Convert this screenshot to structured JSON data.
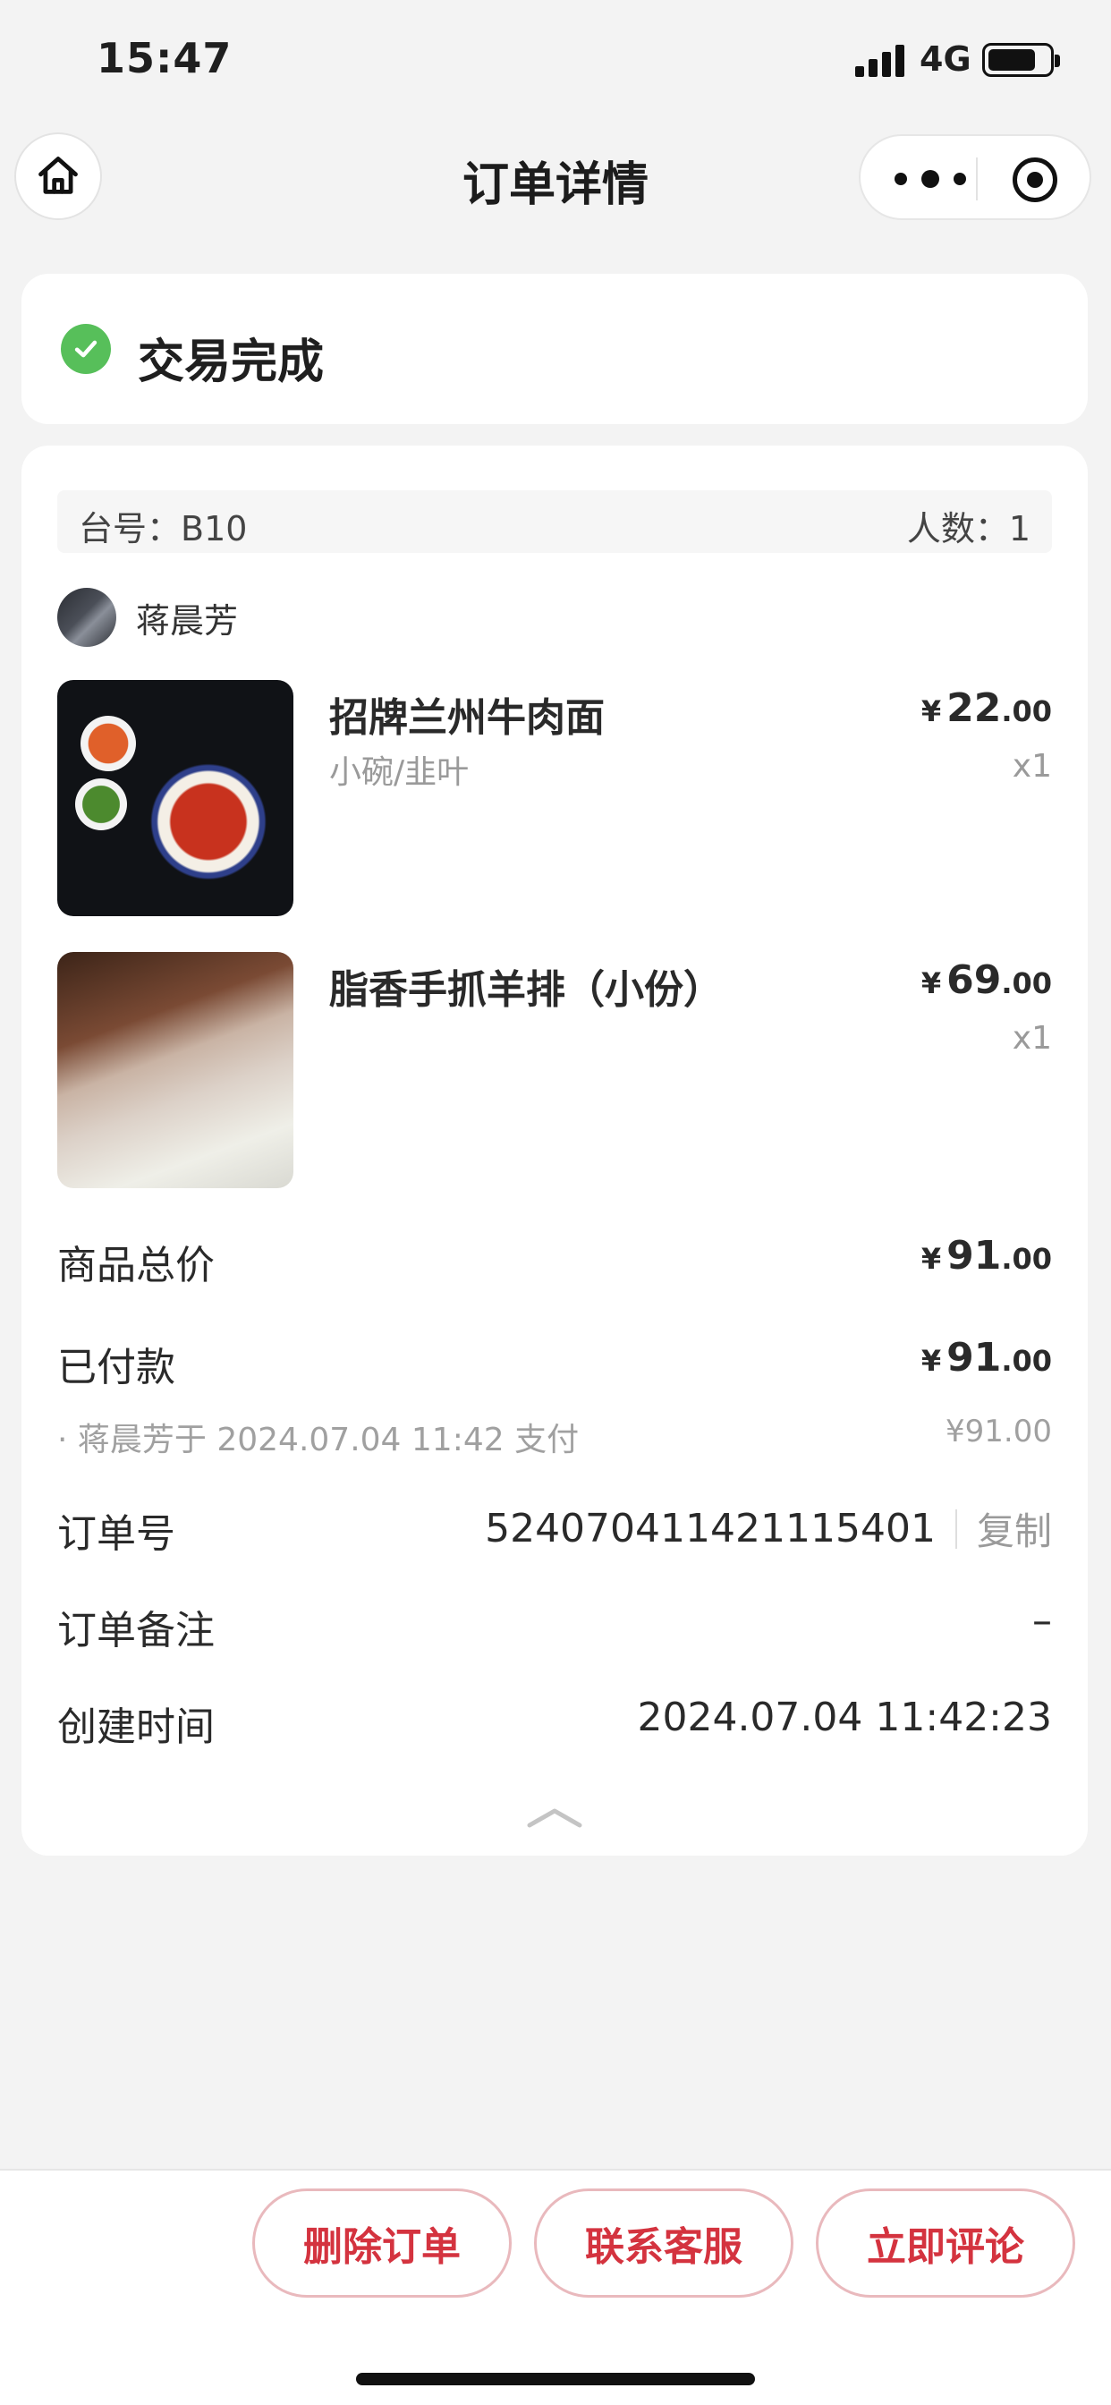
{
  "status_bar": {
    "time": "15:47",
    "network": "4G"
  },
  "nav": {
    "title": "订单详情"
  },
  "order_status": {
    "text": "交易完成"
  },
  "table_info": {
    "table_label": "台号：B10",
    "people_label": "人数：1"
  },
  "customer": {
    "name": "蒋晨芳"
  },
  "items": [
    {
      "name": "招牌兰州牛肉面",
      "spec": "小碗/韭叶",
      "yen": "¥",
      "price_int": "22",
      "price_dec": ".00",
      "qty": "x1"
    },
    {
      "name": "脂香手抓羊排（小份）",
      "spec": "",
      "yen": "¥",
      "price_int": "69",
      "price_dec": ".00",
      "qty": "x1"
    }
  ],
  "summary": {
    "total_label": "商品总价",
    "total_yen": "¥",
    "total_int": "91",
    "total_dec": ".00",
    "paid_label": "已付款",
    "paid_yen": "¥",
    "paid_int": "91",
    "paid_dec": ".00",
    "pay_note": "· 蒋晨芳于 2024.07.04 11:42 支付",
    "pay_note_amount": "¥91.00"
  },
  "details": {
    "order_no_label": "订单号",
    "order_no": "524070411421115401",
    "copy_label": "复制",
    "remark_label": "订单备注",
    "remark_value": "–",
    "created_label": "创建时间",
    "created_value": "2024.07.04 11:42:23"
  },
  "actions": {
    "delete": "删除订单",
    "contact": "联系客服",
    "review": "立即评论"
  },
  "colors": {
    "accent": "#d4333f",
    "success": "#57bf5a",
    "background": "#f3f3f3"
  }
}
